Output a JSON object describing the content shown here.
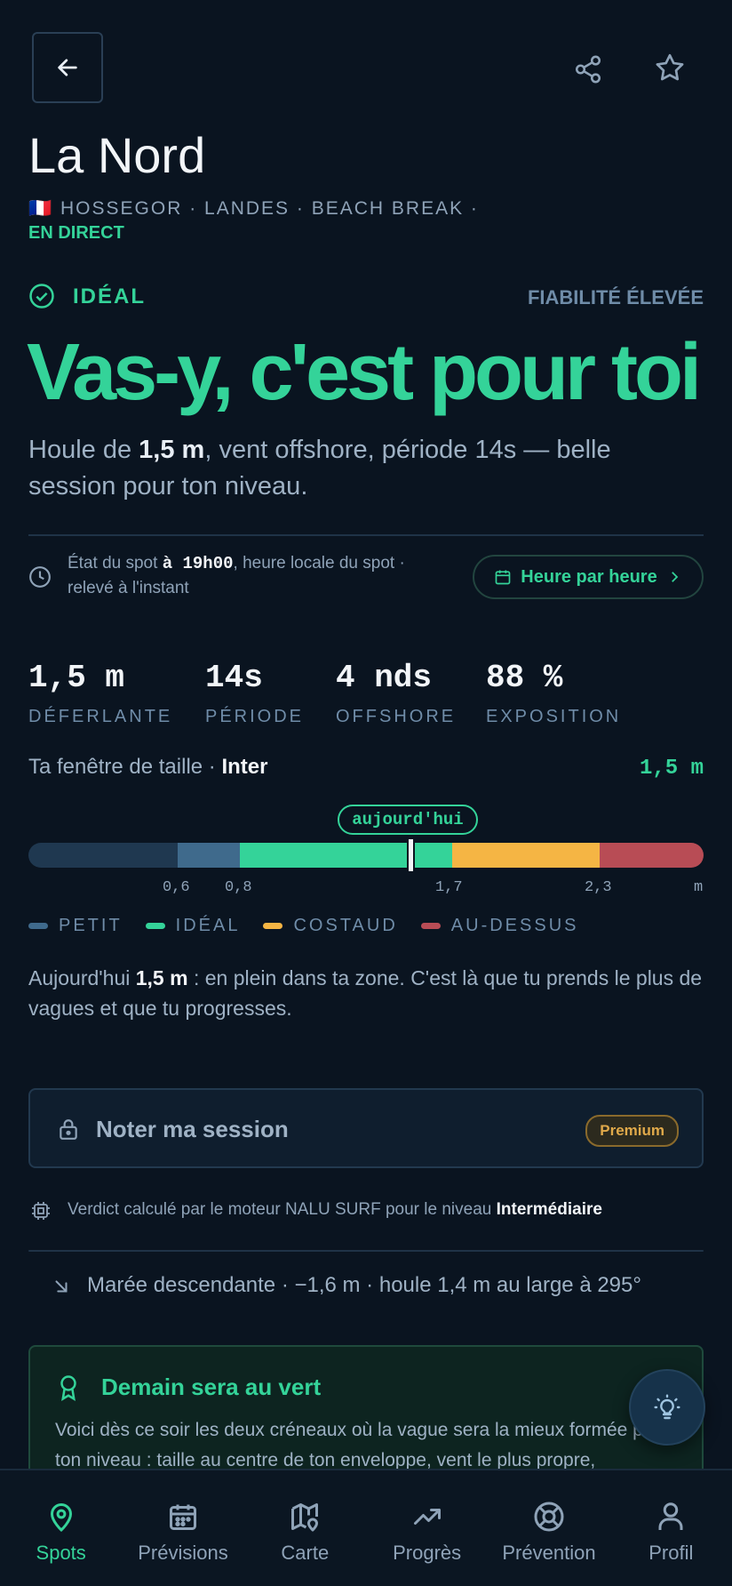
{
  "header": {
    "back_icon": "arrow-left-icon",
    "share_icon": "share-icon",
    "favorite_icon": "star-icon"
  },
  "spot": {
    "name": "La Nord",
    "flag": "🇫🇷",
    "meta": "HOSSEGOR · LANDES · BEACH BREAK ·",
    "live": "EN DIRECT"
  },
  "verdict": {
    "status": "IDÉAL",
    "reliability": "FIABILITÉ ÉLEVÉE",
    "headline": "Vas-y, c'est pour toi",
    "desc_before": "Houle de ",
    "desc_bold": "1,5 m",
    "desc_after": ", vent offshore, période 14s — belle session pour ton niveau."
  },
  "state": {
    "prefix": "État du spot ",
    "time": "à 19h00",
    "suffix": ", heure locale du spot · relevé à l'instant",
    "hourly_button": "Heure par heure"
  },
  "stats": [
    {
      "value": "1,5 m",
      "label": "DÉFERLANTE"
    },
    {
      "value": "14s",
      "label": "PÉRIODE"
    },
    {
      "value": "4 nds",
      "label": "OFFSHORE"
    },
    {
      "value": "88 %",
      "label": "EXPOSITION"
    }
  ],
  "size_window": {
    "label": "Ta fenêtre de taille · ",
    "level": "Inter",
    "current": "1,5 m",
    "today_label": "aujourd'hui",
    "current_value_m": 1.5,
    "ticks": [
      "0,6",
      "0,8",
      "1,7",
      "2,3",
      "m"
    ],
    "legend": [
      {
        "label": "PETIT",
        "color": "#3f6a8c"
      },
      {
        "label": "IDÉAL",
        "color": "#34d399"
      },
      {
        "label": "COSTAUD",
        "color": "#f5b544"
      },
      {
        "label": "AU-DESSUS",
        "color": "#b84c55"
      }
    ],
    "note_before": "Aujourd'hui ",
    "note_bold": "1,5 m",
    "note_after": " : en plein dans ta zone. C'est là que tu prends le plus de vagues et que tu progresses."
  },
  "session": {
    "label": "Noter ma session",
    "badge": "Premium"
  },
  "engine": {
    "text": "Verdict calculé par le moteur NALU SURF pour le niveau ",
    "level": "Intermédiaire"
  },
  "tide": {
    "text": "Marée descendante · −1,6 m · houle 1,4 m au large à 295°"
  },
  "tomorrow": {
    "title": "Demain sera au vert",
    "body": "Voici dès ce soir les deux créneaux où la vague sera la mieux formée pour ton niveau : taille au centre de ton enveloppe, vent le plus propre,"
  },
  "nav": [
    {
      "label": "Spots",
      "icon": "map-pin-icon",
      "active": true
    },
    {
      "label": "Prévisions",
      "icon": "calendar-icon",
      "active": false
    },
    {
      "label": "Carte",
      "icon": "map-icon",
      "active": false
    },
    {
      "label": "Progrès",
      "icon": "trending-up-icon",
      "active": false
    },
    {
      "label": "Prévention",
      "icon": "lifebuoy-icon",
      "active": false
    },
    {
      "label": "Profil",
      "icon": "user-icon",
      "active": false
    }
  ],
  "colors": {
    "accent": "#34d399",
    "background": "#0a1420",
    "muted": "#8fa3b8",
    "premium": "#e0a94a"
  }
}
